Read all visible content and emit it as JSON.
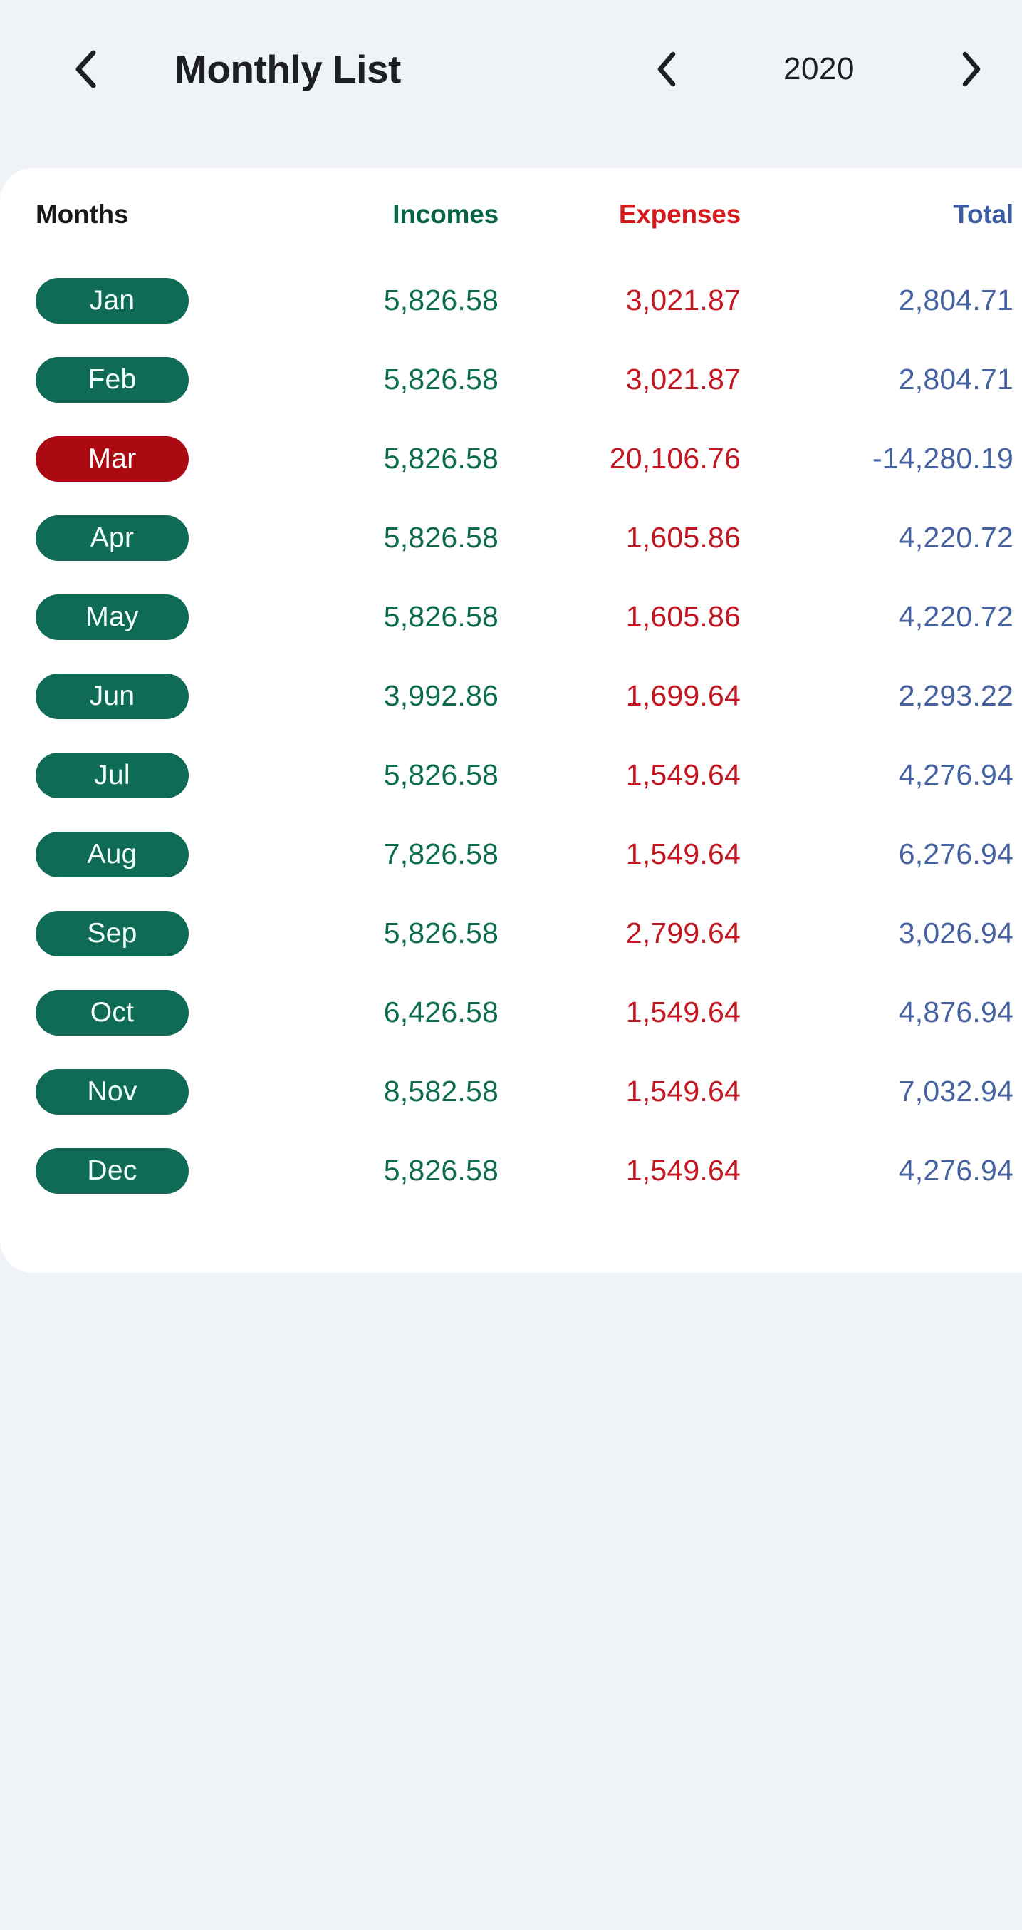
{
  "header": {
    "back_icon": "chevron-left-icon",
    "title": "Monthly List",
    "year_prev_icon": "chevron-left-icon",
    "year": "2020",
    "year_next_icon": "chevron-right-icon"
  },
  "colors": {
    "background": "#eff2f7",
    "card": "#ffffff",
    "income": "#0d6b4f",
    "expense": "#c31620",
    "total": "#45619f",
    "pill_positive": "#0f6b56",
    "pill_negative": "#ac0a12"
  },
  "table": {
    "columns": {
      "months": "Months",
      "incomes": "Incomes",
      "expenses": "Expenses",
      "total": "Total"
    },
    "rows": [
      {
        "month": "Jan",
        "income": "5,826.58",
        "expense": "3,021.87",
        "total": "2,804.71",
        "negative": false
      },
      {
        "month": "Feb",
        "income": "5,826.58",
        "expense": "3,021.87",
        "total": "2,804.71",
        "negative": false
      },
      {
        "month": "Mar",
        "income": "5,826.58",
        "expense": "20,106.76",
        "total": "-14,280.19",
        "negative": true
      },
      {
        "month": "Apr",
        "income": "5,826.58",
        "expense": "1,605.86",
        "total": "4,220.72",
        "negative": false
      },
      {
        "month": "May",
        "income": "5,826.58",
        "expense": "1,605.86",
        "total": "4,220.72",
        "negative": false
      },
      {
        "month": "Jun",
        "income": "3,992.86",
        "expense": "1,699.64",
        "total": "2,293.22",
        "negative": false
      },
      {
        "month": "Jul",
        "income": "5,826.58",
        "expense": "1,549.64",
        "total": "4,276.94",
        "negative": false
      },
      {
        "month": "Aug",
        "income": "7,826.58",
        "expense": "1,549.64",
        "total": "6,276.94",
        "negative": false
      },
      {
        "month": "Sep",
        "income": "5,826.58",
        "expense": "2,799.64",
        "total": "3,026.94",
        "negative": false
      },
      {
        "month": "Oct",
        "income": "6,426.58",
        "expense": "1,549.64",
        "total": "4,876.94",
        "negative": false
      },
      {
        "month": "Nov",
        "income": "8,582.58",
        "expense": "1,549.64",
        "total": "7,032.94",
        "negative": false
      },
      {
        "month": "Dec",
        "income": "5,826.58",
        "expense": "1,549.64",
        "total": "4,276.94",
        "negative": false
      }
    ]
  }
}
